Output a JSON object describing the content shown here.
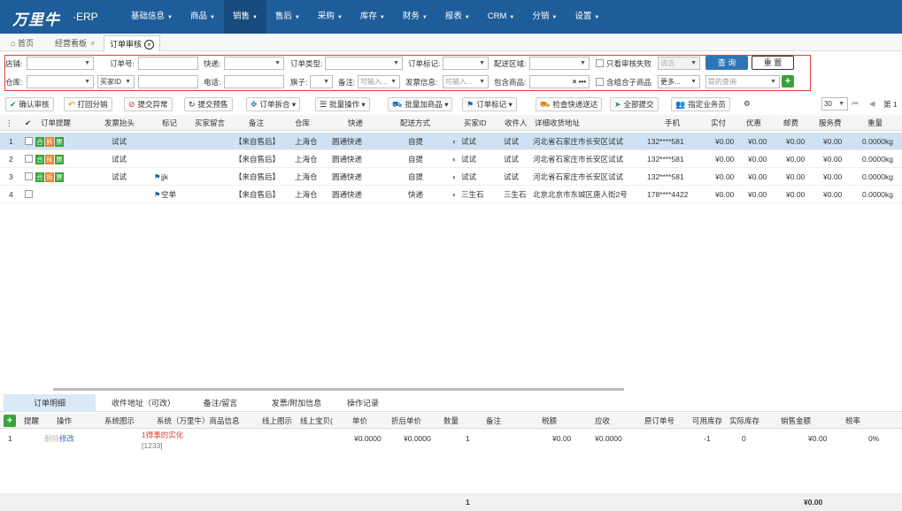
{
  "app": {
    "logo_text": "万里牛",
    "erp": "·ERP"
  },
  "nav": [
    {
      "label": "基础信息",
      "active": false
    },
    {
      "label": "商品",
      "active": false
    },
    {
      "label": "销售",
      "active": true
    },
    {
      "label": "售后",
      "active": false
    },
    {
      "label": "采购",
      "active": false
    },
    {
      "label": "库存",
      "active": false
    },
    {
      "label": "财务",
      "active": false
    },
    {
      "label": "报表",
      "active": false
    },
    {
      "label": "CRM",
      "active": false
    },
    {
      "label": "分销",
      "active": false
    },
    {
      "label": "设置",
      "active": false
    }
  ],
  "tabs": {
    "home": "首页",
    "dashboard": "经营看板",
    "audit": "订单审核"
  },
  "filter": {
    "shop": "店铺:",
    "order_no": "订单号:",
    "express": "快递:",
    "order_type": "订单类型:",
    "order_mark": "订单标记:",
    "region": "配送区域:",
    "only_failed": "只看审核失败",
    "failed_ph": "请选",
    "query": "查 询",
    "reset": "重 置",
    "warehouse": "仓库:",
    "buyer_id": "买家ID",
    "phone": "电话:",
    "flag": "旗子:",
    "remark": "备注:",
    "remark_ph": "可输入...",
    "invoice": "发票信息:",
    "invoice_ph": "可输入...",
    "contains_goods": "包含商品:",
    "x_dots": "× •••",
    "combo": "含组合子商品",
    "more": "更多...",
    "salesman_ph": "提的查询"
  },
  "toolbar": {
    "confirm": "确认审核",
    "split": "打回分销",
    "submit_exception": "提交异常",
    "submit_presale": "提交预售",
    "split_merge": "订单拆合",
    "batch_op": "批量操作",
    "batch_add": "批量加商品",
    "order_mark": "订单标记",
    "check_express": "检查快递送达",
    "submit_all": "全部提交",
    "assign": "指定业务员",
    "page_size": "30",
    "page_label": "第 1"
  },
  "columns": [
    "订单提醒",
    "发票抬头",
    "标记",
    "买家留言",
    "备注",
    "仓库",
    "快递",
    "配送方式",
    "买家ID",
    "收件人",
    "详细收货地址",
    "手机",
    "实付",
    "优惠",
    "邮费",
    "服务费",
    "重量"
  ],
  "badges": {
    "he": "合",
    "chai": "拆",
    "piao": "票"
  },
  "rows": [
    {
      "no": "1",
      "invoice": "试试",
      "mark": "",
      "msg": "",
      "remark": "【来自售后】",
      "wh": "上海仓",
      "express": "圆通快递",
      "ship": "自提",
      "buyer": "试试",
      "recv": "试试",
      "addr": "河北省石家庄市长安区试试",
      "phone": "132****581",
      "paid": "¥0.00",
      "disc": "¥0.00",
      "post": "¥0.00",
      "svc": "¥0.00",
      "weight": "0.0000kg",
      "badges": true,
      "selected": true
    },
    {
      "no": "2",
      "invoice": "试试",
      "mark": "",
      "msg": "",
      "remark": "【来自售后】",
      "wh": "上海仓",
      "express": "圆通快递",
      "ship": "自提",
      "buyer": "试试",
      "recv": "试试",
      "addr": "河北省石家庄市长安区试试",
      "phone": "132****581",
      "paid": "¥0.00",
      "disc": "¥0.00",
      "post": "¥0.00",
      "svc": "¥0.00",
      "weight": "0.0000kg",
      "badges": true,
      "selected": false
    },
    {
      "no": "3",
      "invoice": "试试",
      "mark": "jjk",
      "msg": "",
      "remark": "【来自售后】",
      "wh": "上海仓",
      "express": "圆通快递",
      "ship": "自提",
      "buyer": "试试",
      "recv": "试试",
      "addr": "河北省石家庄市长安区试试",
      "phone": "132****581",
      "paid": "¥0.00",
      "disc": "¥0.00",
      "post": "¥0.00",
      "svc": "¥0.00",
      "weight": "0.0000kg",
      "badges": true,
      "selected": false
    },
    {
      "no": "4",
      "invoice": "",
      "mark": "空单",
      "msg": "",
      "remark": "【来自售后】",
      "wh": "上海仓",
      "express": "圆通快递",
      "ship": "快递",
      "buyer": "三生石",
      "recv": "三生石",
      "addr": "北京北京市东城区唐人街2号",
      "phone": "178****4422",
      "paid": "¥0.00",
      "disc": "¥0.00",
      "post": "¥0.00",
      "svc": "¥0.00",
      "weight": "0.0000kg",
      "badges": false,
      "selected": false
    }
  ],
  "lower_tabs": [
    "订单明细",
    "收件地址（可改）",
    "备注/留言",
    "发票/附加信息",
    "操作记录"
  ],
  "detail_columns": [
    "提醒",
    "操作",
    "系统图示",
    "系统（万里牛）商品信息",
    "线上图示",
    "线上宝贝(",
    "单价",
    "折后单价",
    "数量",
    "备注",
    "税额",
    "应收",
    "原订单号",
    "可用库存",
    "实际库存",
    "销售金额",
    "税率"
  ],
  "detail_row": {
    "no": "1",
    "delete": "删除",
    "edit": "修改",
    "name": "1得事的实化",
    "code": "[1233]",
    "price": "¥0.0000",
    "disc_price": "¥0.0000",
    "qty": "1",
    "tax": "¥0.00",
    "receivable": "¥0.0000",
    "avail": "-1",
    "actual": "0",
    "amount": "¥0.00",
    "rate": "0%"
  },
  "footer": {
    "qty": "1",
    "amount": "¥0.00"
  }
}
